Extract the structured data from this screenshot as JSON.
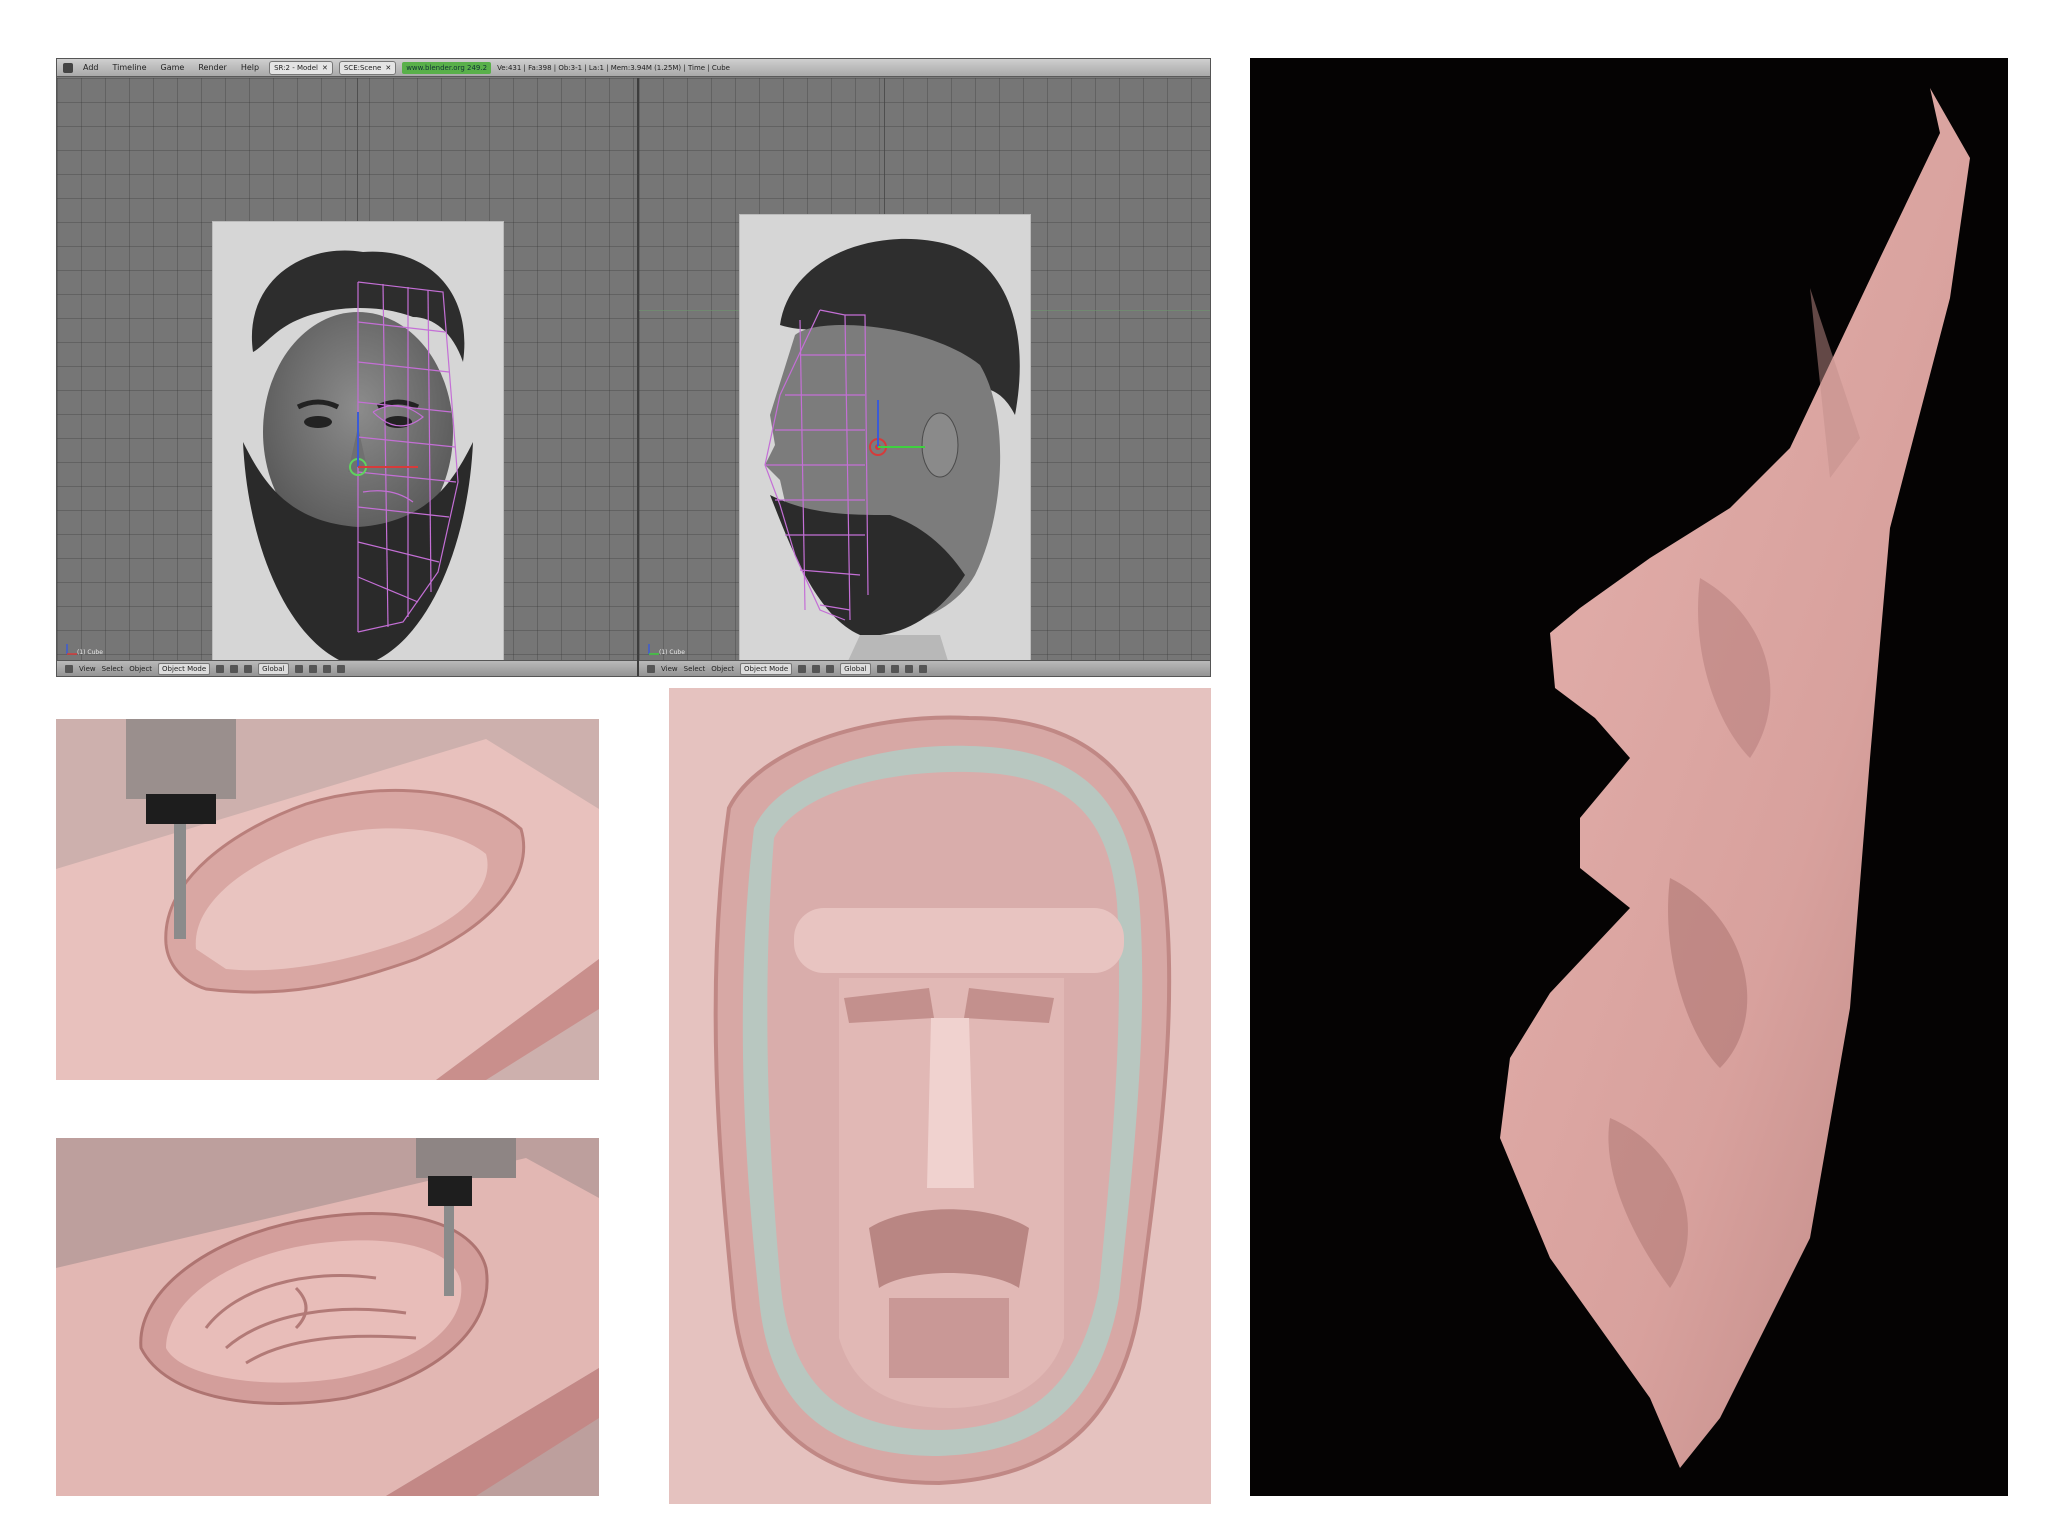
{
  "blender": {
    "menu": [
      "Add",
      "Timeline",
      "Game",
      "Render",
      "Help"
    ],
    "screen_field": "SR:2 - Model",
    "scene_field": "SCE:Scene",
    "version_label": "www.blender.org 249.2",
    "stats": "Ve:431 | Fa:398 | Ob:3-1 | La:1 | Mem:3.94M (1.25M) | Time | Cube",
    "left_view_label": "(1) Cube",
    "right_view_label": "(1) Cube",
    "bottom_bar": {
      "view": "View",
      "select": "Select",
      "object": "Object",
      "mode": "Object Mode",
      "orientation": "Global"
    }
  },
  "colors": {
    "mesh_wire": "#c46fd6",
    "foam_pink": "#dcb0ac",
    "viewport_gray": "#767676",
    "background_black": "#050303"
  },
  "icons": {
    "object_center": "object-origin-icon",
    "manipulator": "transform-manipulator-icon",
    "axis_gizmo": "axis-gizmo-icon"
  }
}
